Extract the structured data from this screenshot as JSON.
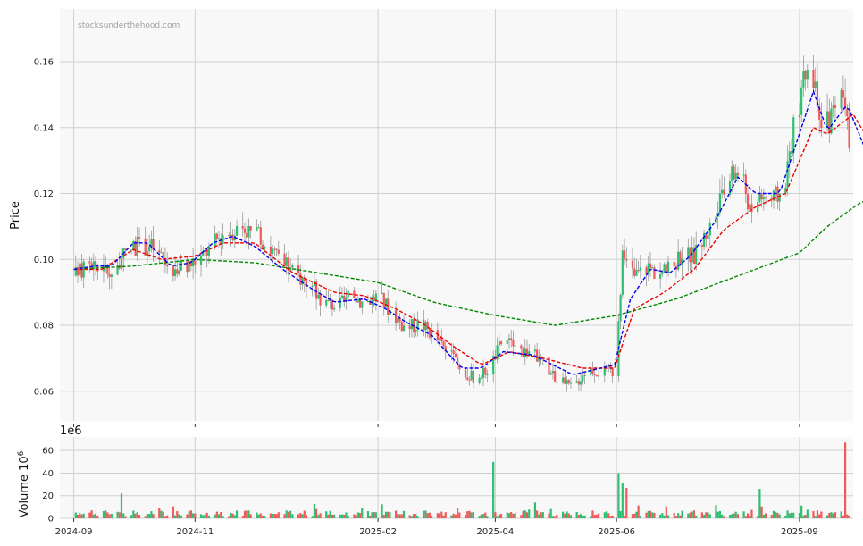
{
  "watermark": "stocksunderthehood.com",
  "chart_data": {
    "type": "candlestick",
    "price_panel": {
      "ylabel": "Price",
      "ylim": [
        0.051,
        0.176
      ],
      "yticks": [
        0.06,
        0.08,
        0.1,
        0.12,
        0.14,
        0.16
      ],
      "ytick_labels": [
        "0.06",
        "0.08",
        "0.10",
        "0.12",
        "0.14",
        "0.16"
      ],
      "grid": true
    },
    "volume_panel": {
      "ylabel": "Volume  10",
      "ylabel_exp": "6",
      "offset_text": "1e6",
      "ylim": [
        0,
        72
      ],
      "yticks": [
        0,
        20,
        40,
        60
      ],
      "ytick_labels": [
        "0",
        "20",
        "40",
        "60"
      ],
      "grid": true
    },
    "x_range": [
      "2024-08-25",
      "2025-09-28"
    ],
    "x_ticks": [
      "2024-09-01",
      "2024-11-01",
      "2025-02-01",
      "2025-04-01",
      "2025-06-01",
      "2025-09-01"
    ],
    "x_tick_labels": [
      "2024-09",
      "2024-11",
      "2025-02",
      "2025-04",
      "2025-06",
      "2025-09"
    ],
    "colors": {
      "up": "#2fbf71",
      "down": "#f05a5a",
      "wick": "#8a8a8a",
      "ma_fast": "#0000ee",
      "ma_mid": "#ee0000",
      "ma_slow": "#008800",
      "panel_bg": "#f8f8f8",
      "grid": "#d0d0d0"
    },
    "close_anchors": [
      [
        "2024-09-01",
        0.095
      ],
      [
        "2024-09-10",
        0.099
      ],
      [
        "2024-09-20",
        0.096
      ],
      [
        "2024-10-01",
        0.104
      ],
      [
        "2024-10-10",
        0.104
      ],
      [
        "2024-10-20",
        0.097
      ],
      [
        "2024-10-28",
        0.098
      ],
      [
        "2024-11-05",
        0.101
      ],
      [
        "2024-11-15",
        0.108
      ],
      [
        "2024-11-25",
        0.11
      ],
      [
        "2024-12-05",
        0.106
      ],
      [
        "2024-12-12",
        0.101
      ],
      [
        "2024-12-20",
        0.096
      ],
      [
        "2024-12-28",
        0.093
      ],
      [
        "2025-01-05",
        0.087
      ],
      [
        "2025-01-12",
        0.086
      ],
      [
        "2025-01-20",
        0.089
      ],
      [
        "2025-01-25",
        0.087
      ],
      [
        "2025-02-01",
        0.089
      ],
      [
        "2025-02-08",
        0.084
      ],
      [
        "2025-02-15",
        0.079
      ],
      [
        "2025-02-22",
        0.081
      ],
      [
        "2025-03-01",
        0.077
      ],
      [
        "2025-03-08",
        0.072
      ],
      [
        "2025-03-15",
        0.066
      ],
      [
        "2025-03-22",
        0.064
      ],
      [
        "2025-03-29",
        0.067
      ],
      [
        "2025-04-05",
        0.076
      ],
      [
        "2025-04-12",
        0.073
      ],
      [
        "2025-04-19",
        0.072
      ],
      [
        "2025-04-26",
        0.068
      ],
      [
        "2025-05-03",
        0.063
      ],
      [
        "2025-05-10",
        0.061
      ],
      [
        "2025-05-17",
        0.067
      ],
      [
        "2025-05-24",
        0.066
      ],
      [
        "2025-05-31",
        0.066
      ],
      [
        "2025-06-04",
        0.1
      ],
      [
        "2025-06-10",
        0.095
      ],
      [
        "2025-06-16",
        0.098
      ],
      [
        "2025-06-22",
        0.096
      ],
      [
        "2025-06-28",
        0.097
      ],
      [
        "2025-07-04",
        0.102
      ],
      [
        "2025-07-10",
        0.101
      ],
      [
        "2025-07-16",
        0.108
      ],
      [
        "2025-07-22",
        0.115
      ],
      [
        "2025-07-28",
        0.125
      ],
      [
        "2025-08-01",
        0.127
      ],
      [
        "2025-08-05",
        0.121
      ],
      [
        "2025-08-08",
        0.112
      ],
      [
        "2025-08-12",
        0.12
      ],
      [
        "2025-08-18",
        0.118
      ],
      [
        "2025-08-24",
        0.121
      ],
      [
        "2025-08-29",
        0.14
      ],
      [
        "2025-09-02",
        0.15
      ],
      [
        "2025-09-05",
        0.158
      ],
      [
        "2025-09-08",
        0.155
      ],
      [
        "2025-09-11",
        0.139
      ],
      [
        "2025-09-14",
        0.141
      ],
      [
        "2025-09-17",
        0.143
      ],
      [
        "2025-09-20",
        0.146
      ],
      [
        "2025-09-23",
        0.148
      ],
      [
        "2025-09-26",
        0.135
      ]
    ],
    "volume_spikes": [
      [
        "2024-09-25",
        22
      ],
      [
        "2025-03-31",
        50
      ],
      [
        "2025-05-31",
        45
      ],
      [
        "2025-06-02",
        40
      ],
      [
        "2025-06-04",
        31
      ],
      [
        "2025-06-06",
        27
      ],
      [
        "2025-08-12",
        26
      ],
      [
        "2025-09-24",
        67
      ]
    ],
    "ma_fast_anchors": [
      [
        "2024-09-01",
        0.097
      ],
      [
        "2024-09-12",
        0.098
      ],
      [
        "2024-09-20",
        0.098
      ],
      [
        "2024-10-01",
        0.105
      ],
      [
        "2024-10-08",
        0.105
      ],
      [
        "2024-10-20",
        0.098
      ],
      [
        "2024-10-30",
        0.099
      ],
      [
        "2024-11-10",
        0.105
      ],
      [
        "2024-11-20",
        0.107
      ],
      [
        "2024-12-01",
        0.104
      ],
      [
        "2024-12-15",
        0.097
      ],
      [
        "2024-12-30",
        0.091
      ],
      [
        "2025-01-10",
        0.087
      ],
      [
        "2025-01-25",
        0.088
      ],
      [
        "2025-02-05",
        0.085
      ],
      [
        "2025-02-15",
        0.081
      ],
      [
        "2025-02-28",
        0.077
      ],
      [
        "2025-03-15",
        0.067
      ],
      [
        "2025-03-25",
        0.067
      ],
      [
        "2025-04-05",
        0.072
      ],
      [
        "2025-04-20",
        0.071
      ],
      [
        "2025-05-10",
        0.065
      ],
      [
        "2025-05-31",
        0.068
      ],
      [
        "2025-06-08",
        0.088
      ],
      [
        "2025-06-18",
        0.097
      ],
      [
        "2025-06-28",
        0.096
      ],
      [
        "2025-07-08",
        0.101
      ],
      [
        "2025-07-20",
        0.111
      ],
      [
        "2025-08-01",
        0.125
      ],
      [
        "2025-08-10",
        0.12
      ],
      [
        "2025-08-22",
        0.12
      ],
      [
        "2025-09-02",
        0.14
      ],
      [
        "2025-09-08",
        0.151
      ],
      [
        "2025-09-15",
        0.139
      ],
      [
        "2025-09-25",
        0.147
      ],
      [
        "2025-10-05",
        0.132
      ],
      [
        "2025-10-12",
        0.135
      ]
    ],
    "ma_mid_anchors": [
      [
        "2024-09-01",
        0.097
      ],
      [
        "2024-09-15",
        0.097
      ],
      [
        "2024-10-01",
        0.103
      ],
      [
        "2024-10-15",
        0.1
      ],
      [
        "2024-11-01",
        0.101
      ],
      [
        "2024-11-15",
        0.105
      ],
      [
        "2024-12-01",
        0.105
      ],
      [
        "2024-12-20",
        0.096
      ],
      [
        "2025-01-10",
        0.09
      ],
      [
        "2025-01-25",
        0.089
      ],
      [
        "2025-02-10",
        0.085
      ],
      [
        "2025-02-25",
        0.08
      ],
      [
        "2025-03-10",
        0.074
      ],
      [
        "2025-03-25",
        0.068
      ],
      [
        "2025-04-08",
        0.072
      ],
      [
        "2025-04-25",
        0.07
      ],
      [
        "2025-05-15",
        0.067
      ],
      [
        "2025-05-31",
        0.067
      ],
      [
        "2025-06-10",
        0.085
      ],
      [
        "2025-06-25",
        0.09
      ],
      [
        "2025-07-10",
        0.097
      ],
      [
        "2025-07-25",
        0.109
      ],
      [
        "2025-08-10",
        0.116
      ],
      [
        "2025-08-25",
        0.12
      ],
      [
        "2025-09-08",
        0.14
      ],
      [
        "2025-09-15",
        0.138
      ],
      [
        "2025-09-28",
        0.144
      ],
      [
        "2025-10-05",
        0.137
      ],
      [
        "2025-10-12",
        0.136
      ]
    ],
    "ma_slow_anchors": [
      [
        "2024-09-01",
        0.097
      ],
      [
        "2024-10-01",
        0.098
      ],
      [
        "2024-11-01",
        0.1
      ],
      [
        "2024-12-01",
        0.099
      ],
      [
        "2025-01-01",
        0.096
      ],
      [
        "2025-02-01",
        0.093
      ],
      [
        "2025-03-01",
        0.087
      ],
      [
        "2025-04-01",
        0.083
      ],
      [
        "2025-05-01",
        0.08
      ],
      [
        "2025-06-01",
        0.083
      ],
      [
        "2025-07-01",
        0.088
      ],
      [
        "2025-08-01",
        0.095
      ],
      [
        "2025-09-01",
        0.102
      ],
      [
        "2025-09-15",
        0.11
      ],
      [
        "2025-10-01",
        0.117
      ],
      [
        "2025-10-12",
        0.12
      ]
    ]
  }
}
